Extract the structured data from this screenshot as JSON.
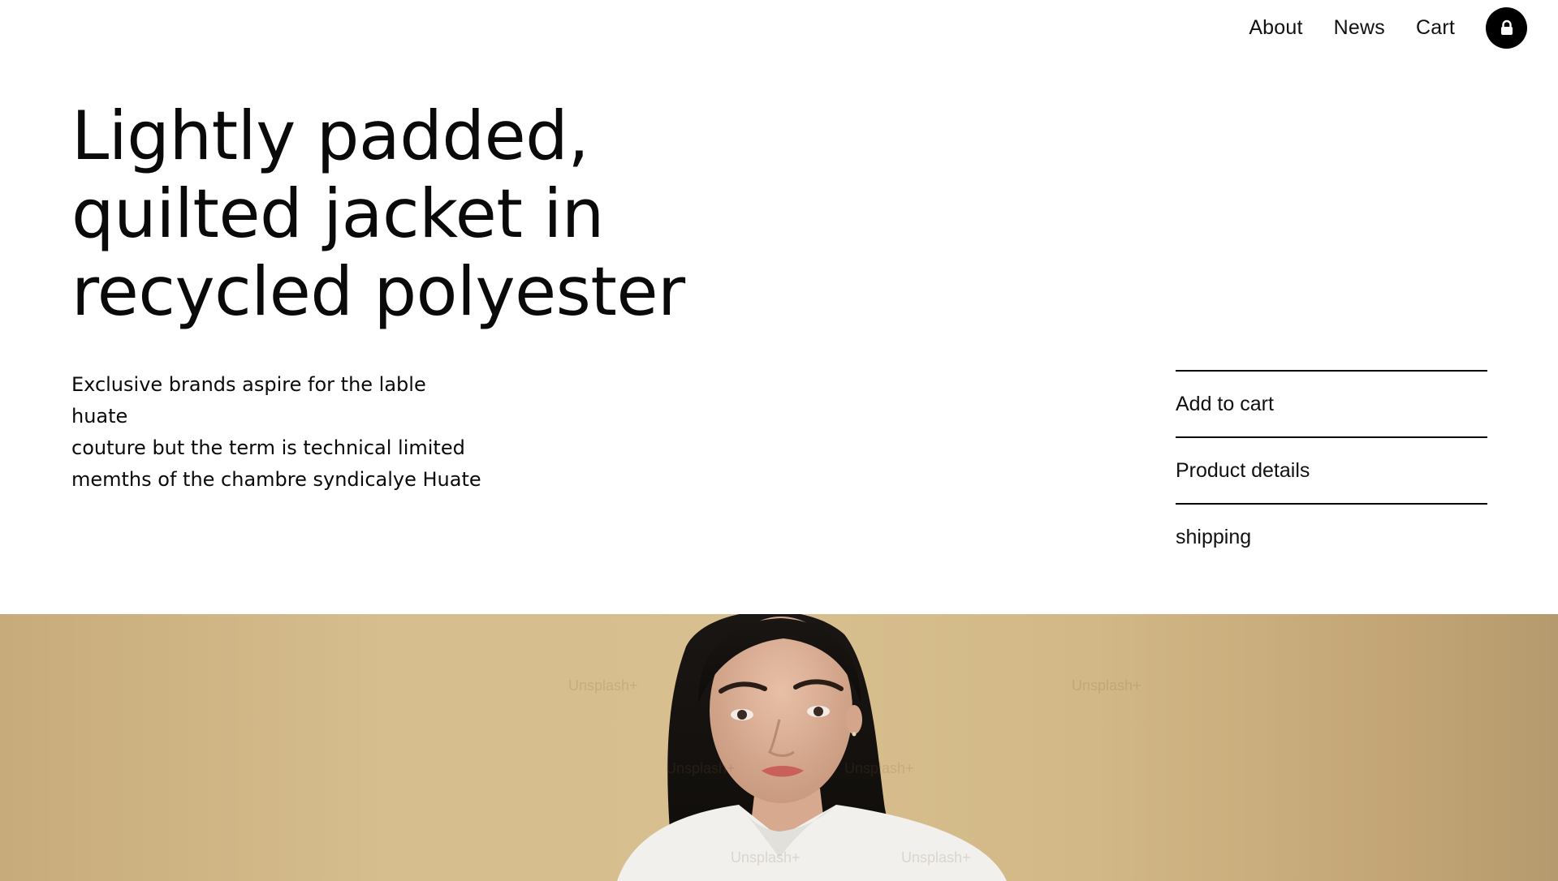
{
  "nav": {
    "items": [
      "About",
      "News",
      "Cart"
    ],
    "lock_icon": "lock-icon"
  },
  "hero": {
    "title": "Lightly padded, quilted jacket in recycled polyester",
    "title_lines": [
      "Lightly padded,",
      "quilted jacket in",
      "recycled polyester"
    ],
    "description_lines": [
      "Exclusive brands aspire for the lable huate",
      "couture but the term is technical limited",
      "memths of the chambre syndicalye Huate"
    ]
  },
  "side_menu": {
    "items": [
      "Add to cart",
      "Product details",
      "shipping"
    ]
  },
  "photo": {
    "watermark": "Unsplash+"
  },
  "colors": {
    "accent": "#000000",
    "photo_bg": "#d6be8e"
  }
}
